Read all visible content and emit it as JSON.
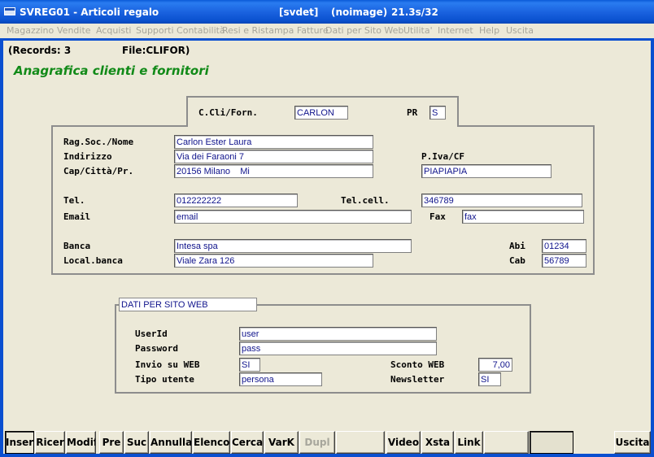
{
  "window": {
    "title": "SVREG01 - Articoli regalo",
    "info1": "[svdet]",
    "info2": "(noimage)",
    "info3": "21.3s/32"
  },
  "menu": [
    "Magazzino",
    "Vendite",
    "Acquisti",
    "Supporti Contabilità",
    "Resi e Ristampa Fatture",
    "Dati per Sito Web",
    "Utilita'",
    "Internet",
    "Help",
    "Uscita"
  ],
  "status": {
    "records": "(Records: 3",
    "file": "File:CLIFOR)"
  },
  "page_title": "Anagrafica clienti e fornitori",
  "code_box": {
    "label": "C.Cli/Forn.",
    "value": "CARLON",
    "pr_label": "PR",
    "pr_value": "S"
  },
  "main_form": {
    "ragsoc_label": "Rag.Soc./Nome",
    "ragsoc_value": "Carlon Ester Laura",
    "indirizzo_label": "Indirizzo",
    "indirizzo_value": "Via dei Faraoni 7",
    "piva_label": "P.Iva/CF",
    "cap_label": "Cap/Città/Pr.",
    "cap_value": "20156 Milano    Mi",
    "piva_value": "PIAPIAPIA",
    "tel_label": "Tel.",
    "tel_value": "012222222",
    "telcell_label": "Tel.cell.",
    "telcell_value": "346789",
    "email_label": "Email",
    "email_value": "email",
    "fax_label": "Fax",
    "fax_value": "fax",
    "banca_label": "Banca",
    "banca_value": "Intesa spa",
    "abi_label": "Abi",
    "abi_value": "01234",
    "localbanca_label": "Local.banca",
    "localbanca_value": "Viale Zara 126",
    "cab_label": "Cab",
    "cab_value": "56789"
  },
  "web_form": {
    "legend": "DATI PER SITO WEB",
    "userid_label": "UserId",
    "userid_value": "user",
    "password_label": "Password",
    "password_value": "pass",
    "invio_label": "Invio su WEB",
    "invio_value": "SI",
    "sconto_label": "Sconto WEB",
    "sconto_value": "7,00",
    "tipo_label": "Tipo utente",
    "tipo_value": "persona",
    "newsletter_label": "Newsletter",
    "newsletter_value": "SI"
  },
  "toolbar": {
    "inser": "Inser",
    "ricer": "Ricer",
    "modif": "Modif",
    "pre": "Pre",
    "suc": "Suc",
    "annulla": "Annulla",
    "elenco": "Elenco",
    "cerca": "Cerca",
    "vark": "VarK",
    "dupl": "Dupl",
    "video": "Video",
    "xsta": "Xsta",
    "link": "Link",
    "uscita": "Uscita"
  }
}
